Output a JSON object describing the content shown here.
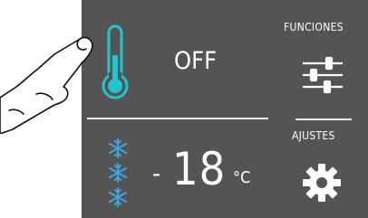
{
  "power": {
    "state": "OFF"
  },
  "sidebar": {
    "funciones_label": "FUNCIONES",
    "ajustes_label": "AJUSTES"
  },
  "temperature": {
    "sign": "-",
    "value": "18",
    "unit": "°C"
  },
  "icons": {
    "thermometer": "thermometer-icon",
    "sliders": "sliders-icon",
    "gear": "gear-icon",
    "snowflakes": "snowflake-icon"
  },
  "colors": {
    "panel": "#555454",
    "accent": "#22c4cf",
    "snow": "#3aa7e0",
    "text": "#ffffff"
  }
}
